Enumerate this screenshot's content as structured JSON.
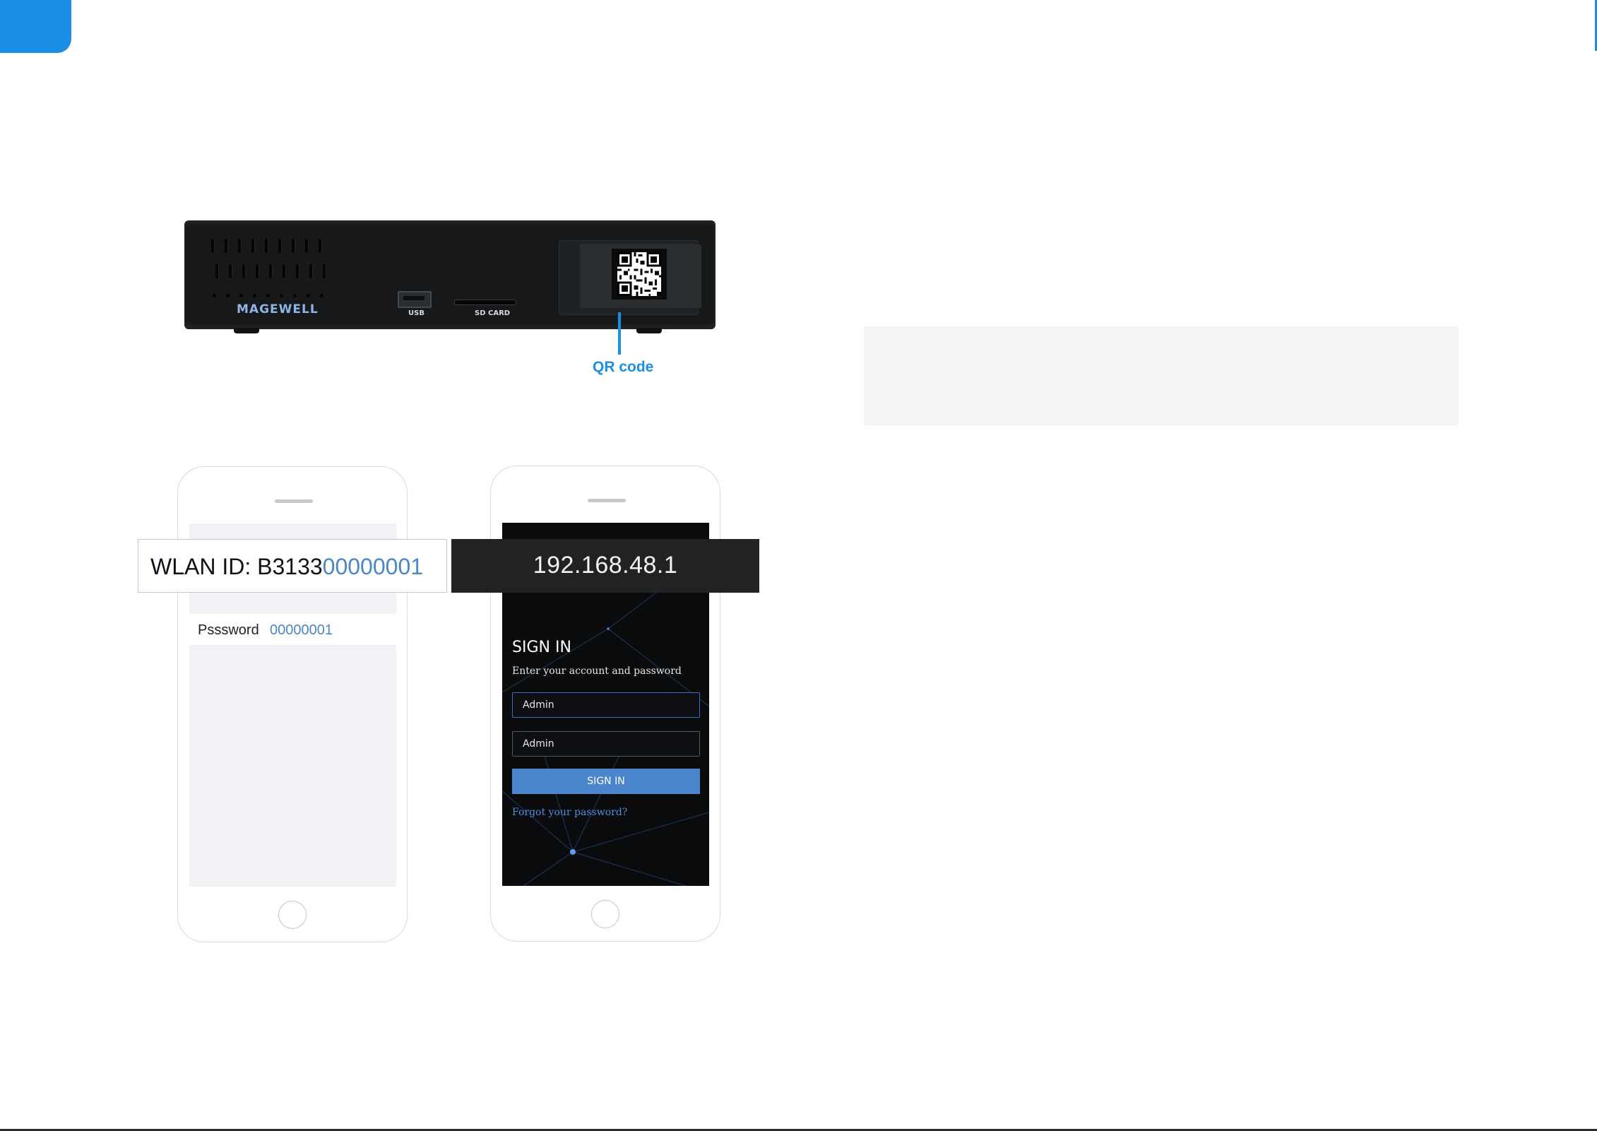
{
  "device": {
    "brand": "MAGEWELL",
    "usb_label": "USB",
    "sd_label": "SD CARD",
    "qr_callout": "QR code"
  },
  "wifi_phone": {
    "wlan_prefix": "WLAN ID: B3133",
    "wlan_suffix": "00000001",
    "password_label": "Psssword",
    "password_value": "00000001"
  },
  "web_phone": {
    "ip_address": "192.168.48.1",
    "sign_in_title": "SIGN IN",
    "sign_in_subtitle": "Enter your account and password",
    "username_value": "Admin",
    "password_value": "Admin",
    "sign_in_button": "SIGN IN",
    "forgot_link": "Forgot your password?"
  },
  "colors": {
    "accent": "#1a8fe3",
    "highlight_text": "#4a87c9",
    "button": "#4b86cc"
  }
}
